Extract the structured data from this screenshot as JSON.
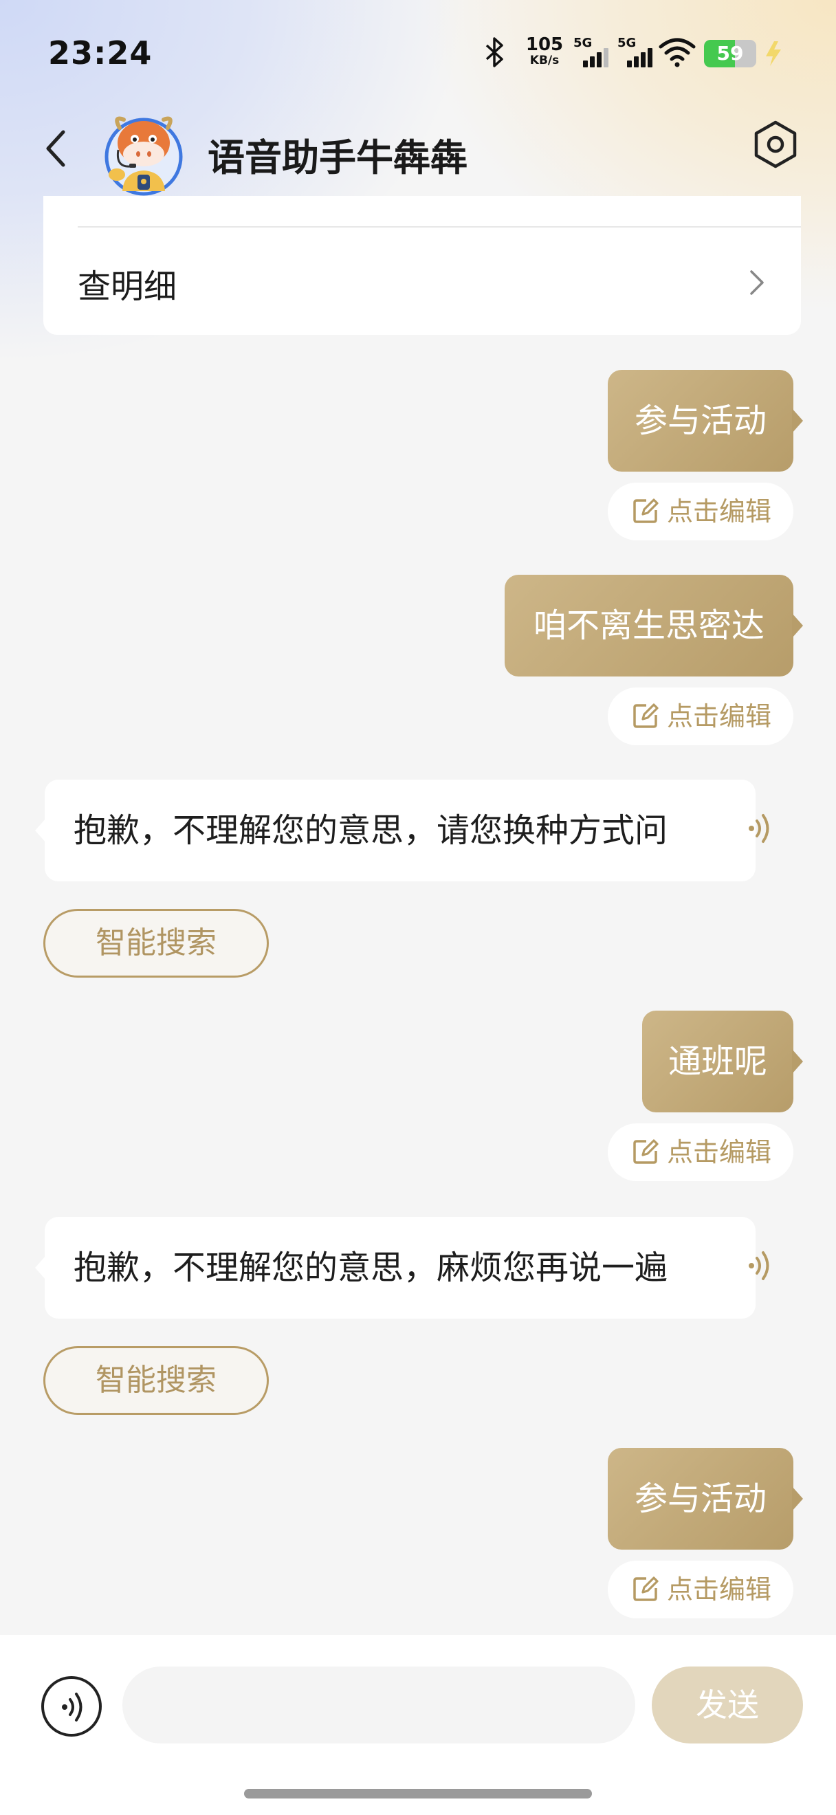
{
  "status_bar": {
    "time": "23:24",
    "net_speed_value": "105",
    "net_speed_unit": "KB/s",
    "signal1_label": "5G",
    "signal2_label": "5G",
    "battery_level": "59",
    "battery_fraction": 0.59,
    "icons": [
      "bluetooth-icon",
      "signal-icon",
      "wifi-icon",
      "battery-icon",
      "charging-icon"
    ]
  },
  "nav": {
    "title": "语音助手牛犇犇",
    "back_icon": "chevron-left-icon",
    "settings_icon": "settings-hexagon-icon"
  },
  "detail_card": {
    "label": "查明细"
  },
  "messages": [
    {
      "side": "right",
      "text": "参与活动",
      "edit_label": "点击编辑"
    },
    {
      "side": "right",
      "text": "咱不离生思密达",
      "edit_label": "点击编辑"
    },
    {
      "side": "left",
      "text": "抱歉，不理解您的意思，请您换种方式问",
      "action_label": "智能搜索"
    },
    {
      "side": "right",
      "text": "通班呢",
      "edit_label": "点击编辑"
    },
    {
      "side": "left",
      "text": "抱歉，不理解您的意思，麻烦您再说一遍",
      "action_label": "智能搜索"
    },
    {
      "side": "right",
      "text": "参与活动",
      "edit_label": "点击编辑"
    }
  ],
  "input_bar": {
    "placeholder": "",
    "send_label": "发送"
  },
  "colors": {
    "accent_gold": "#b79d6a",
    "send_disabled": "#e2d6bc",
    "battery_green": "#45c94f"
  }
}
